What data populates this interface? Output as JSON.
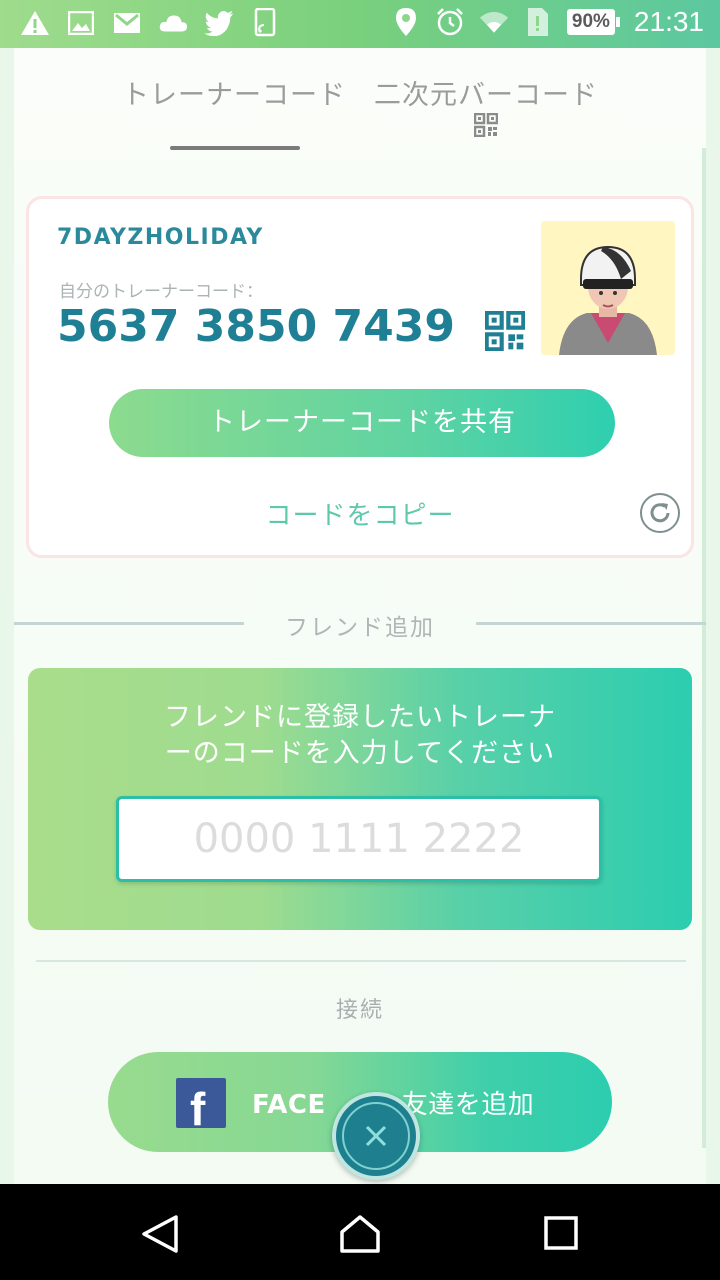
{
  "status_bar": {
    "battery": "90%",
    "time": "21:31",
    "icons": [
      "warning-icon",
      "image-icon",
      "gmail-icon",
      "cloud-icon",
      "twitter-icon",
      "cast-icon",
      "location-icon",
      "alarm-icon",
      "wifi-icon",
      "sim-icon"
    ]
  },
  "tabs": {
    "trainer_code": "トレーナーコード",
    "qr_code": "二次元バーコード",
    "active": "trainer_code"
  },
  "trainer_card": {
    "name": "7DAYZHOLIDAY",
    "code_label": "自分のトレーナーコード：",
    "code_value": "5637 3850 7439",
    "share_button": "トレーナーコードを共有",
    "copy_link": "コードをコピー"
  },
  "add_friend": {
    "section_title": "フレンド追加",
    "prompt_line1": "フレンドに登録したいトレーナ",
    "prompt_line2": "ーのコードを入力してください",
    "input_placeholder": "0000 1111 2222",
    "input_value": ""
  },
  "connect": {
    "section_title": "接続",
    "facebook_bold": "FACE",
    "facebook_rest": "友達を追加"
  },
  "colors": {
    "accent": "#2ccdb0",
    "code_text": "#1f7f94",
    "facebook": "#3b5998"
  }
}
